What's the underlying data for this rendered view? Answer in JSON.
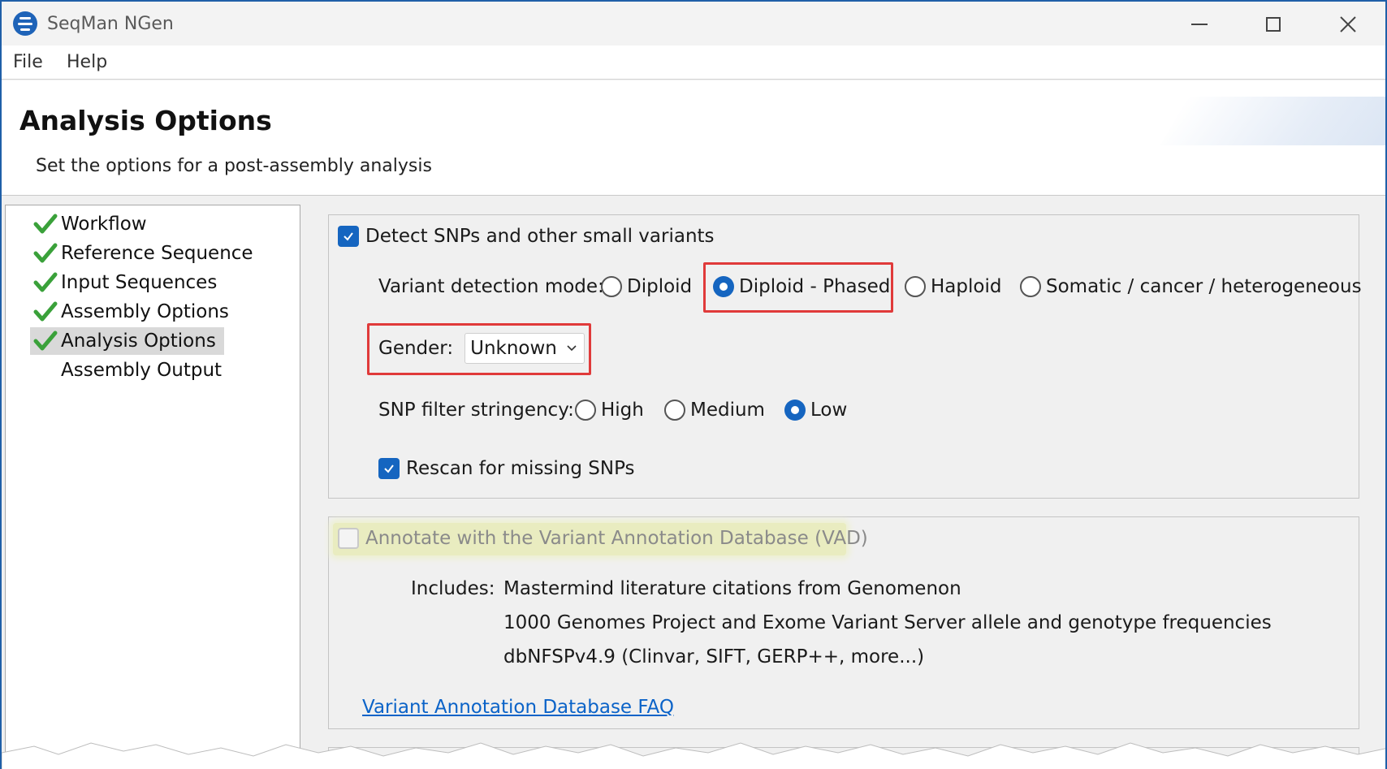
{
  "window": {
    "title": "SeqMan NGen"
  },
  "menu": {
    "file": "File",
    "help": "Help"
  },
  "header": {
    "title": "Analysis Options",
    "subtitle": "Set the options for a post-assembly analysis"
  },
  "sidebar": {
    "items": [
      {
        "label": "Workflow",
        "checked": true,
        "selected": false
      },
      {
        "label": "Reference Sequence",
        "checked": true,
        "selected": false
      },
      {
        "label": "Input Sequences",
        "checked": true,
        "selected": false
      },
      {
        "label": "Assembly Options",
        "checked": true,
        "selected": false
      },
      {
        "label": "Analysis Options",
        "checked": true,
        "selected": true
      },
      {
        "label": "Assembly Output",
        "checked": false,
        "selected": false
      }
    ]
  },
  "snp_panel": {
    "detect_label": "Detect SNPs and other small variants",
    "detect_checked": true,
    "mode_label": "Variant detection mode:",
    "modes": [
      {
        "label": "Diploid",
        "selected": false
      },
      {
        "label": "Diploid - Phased",
        "selected": true
      },
      {
        "label": "Haploid",
        "selected": false
      },
      {
        "label": "Somatic / cancer / heterogeneous",
        "selected": false
      }
    ],
    "gender_label": "Gender:",
    "gender_value": "Unknown",
    "stringency_label": "SNP filter stringency:",
    "stringency": [
      {
        "label": "High",
        "selected": false
      },
      {
        "label": "Medium",
        "selected": false
      },
      {
        "label": "Low",
        "selected": true
      }
    ],
    "rescan_label": "Rescan for missing SNPs",
    "rescan_checked": true
  },
  "vad_panel": {
    "annotate_label": "Annotate with the Variant Annotation Database (VAD)",
    "annotate_checked": false,
    "includes_label": "Includes:",
    "includes": [
      "Mastermind literature citations from Genomenon",
      "1000 Genomes Project and Exome Variant Server allele and genotype frequencies",
      "dbNFSPv4.9 (Clinvar,  SIFT, GERP++, more...)"
    ],
    "faq_link": "Variant Annotation Database FAQ"
  },
  "colors": {
    "accent": "#1565c0",
    "highlight_red": "#e03a3a",
    "highlight_yellow": "#e9ecc0",
    "link": "#0b63c8"
  }
}
